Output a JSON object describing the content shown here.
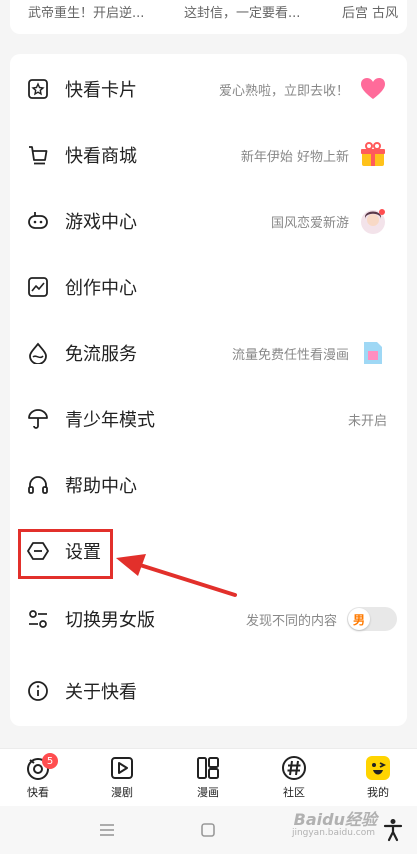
{
  "top_banner": {
    "items": [
      "武帝重生！开启逆...",
      "这封信，一定要看...",
      "后宫 古风"
    ]
  },
  "menu": {
    "items": [
      {
        "label": "快看卡片",
        "right": "爱心熟啦，立即去收！",
        "icon": "card-icon",
        "image": "heart-image"
      },
      {
        "label": "快看商城",
        "right": "新年伊始 好物上新",
        "icon": "cart-icon",
        "image": "gift-image"
      },
      {
        "label": "游戏中心",
        "right": "国风恋爱新游",
        "icon": "gamepad-icon",
        "image": "game-avatar-image"
      },
      {
        "label": "创作中心",
        "right": "",
        "icon": "chart-icon"
      },
      {
        "label": "免流服务",
        "right": "流量免费任性看漫画",
        "icon": "drop-icon",
        "image": "sim-card-image"
      },
      {
        "label": "青少年模式",
        "right": "未开启",
        "icon": "umbrella-icon"
      },
      {
        "label": "帮助中心",
        "right": "",
        "icon": "headphones-icon"
      },
      {
        "label": "设置",
        "right": "",
        "icon": "settings-icon"
      },
      {
        "label": "切换男女版",
        "right": "发现不同的内容",
        "icon": "switch-icon",
        "toggle_label": "男"
      },
      {
        "label": "关于快看",
        "right": "",
        "icon": "info-icon"
      }
    ]
  },
  "bottom_nav": {
    "items": [
      {
        "label": "快看",
        "icon": "kuaikan-icon",
        "badge": "5"
      },
      {
        "label": "漫剧",
        "icon": "play-icon"
      },
      {
        "label": "漫画",
        "icon": "comic-icon"
      },
      {
        "label": "社区",
        "icon": "hashtag-icon"
      },
      {
        "label": "我的",
        "icon": "face-icon",
        "active": true
      }
    ]
  },
  "watermark": {
    "text": "Baidu经验",
    "sub": "jingyan.baidu.com"
  },
  "colors": {
    "highlight": "#e2302b",
    "accent_yellow": "#ffd400",
    "badge": "#ff4d4f"
  }
}
